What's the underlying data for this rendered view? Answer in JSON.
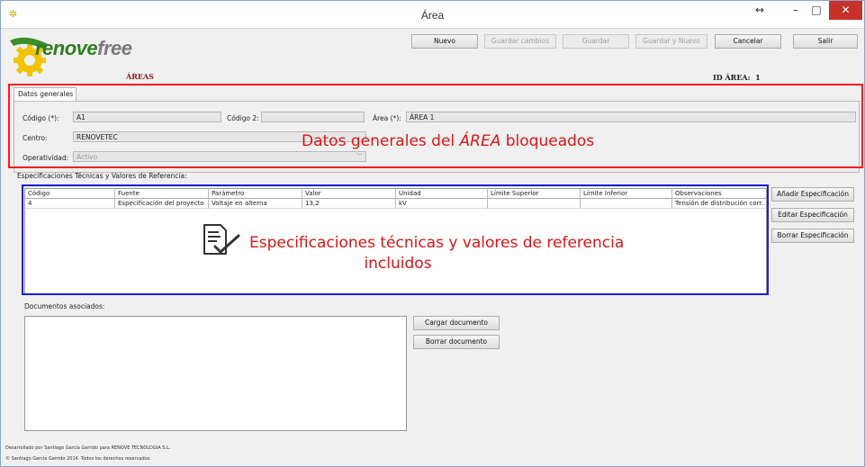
{
  "window": {
    "title": "Área",
    "controls": {
      "resize": "↔",
      "minimize": "–",
      "maximize": "□",
      "close": "✕"
    }
  },
  "logo": {
    "part1": "renove",
    "part2": "free"
  },
  "header": {
    "section": "ÁREAS",
    "id_label": "ID ÁREA:",
    "id_value": "1"
  },
  "toolbar": {
    "nuevo": "Nuevo",
    "guardar_cambios": "Guardar cambios",
    "guardar": "Guardar",
    "guardar_nuevo": "Guardar y Nuevo",
    "cancelar": "Cancelar",
    "salir": "Salir"
  },
  "tab": {
    "label": "Datos generales"
  },
  "general": {
    "codigo_label": "Código (*):",
    "codigo_value": "A1",
    "codigo2_label": "Código 2:",
    "codigo2_value": "",
    "area_label": "Área (*):",
    "area_value": "ÁREA 1",
    "centro_label": "Centro:",
    "centro_value": "RENOVETEC",
    "operatividad_label": "Operatividad:",
    "operatividad_value": "Activo"
  },
  "annotations": {
    "red_prefix": "Datos generales del ",
    "red_italic": "ÁREA",
    "red_suffix": " bloqueados",
    "blue_line1": "Especificaciones técnicas y valores de referencia",
    "blue_line2": "incluidos"
  },
  "specs": {
    "section_label": "Especificaciones Técnicas y Valores de Referencia:",
    "columns": [
      "Código",
      "Fuente",
      "Parámetro",
      "Valor",
      "Unidad",
      "Límite Superior",
      "Límite Inferior",
      "Observaciones"
    ],
    "rows": [
      [
        "4",
        "Especificación del proyecto",
        "Voltaje en alterna",
        "13,2",
        "kV",
        "",
        "",
        "Tensión de distribución corr..."
      ]
    ],
    "add_button": "Añadir Especificación",
    "edit_button": "Editar Especificación",
    "delete_button": "Borrar Especificación"
  },
  "documents": {
    "section_label": "Documentos asociados:",
    "load_button": "Cargar documento",
    "delete_button": "Borrar documento"
  },
  "footer": {
    "line1": "Desarrollado por Santiago García Garrido para RENOVE TECNOLOGIA S.L.",
    "line2": "© Santiago García Garrido 2014. Todos los derechos reservados."
  },
  "colors": {
    "annotation_red": "#e01515",
    "box_red": "#ff1a1a",
    "box_blue": "#1b1bdf",
    "logo_green": "#2f7d20",
    "close_red": "#c7312a"
  }
}
